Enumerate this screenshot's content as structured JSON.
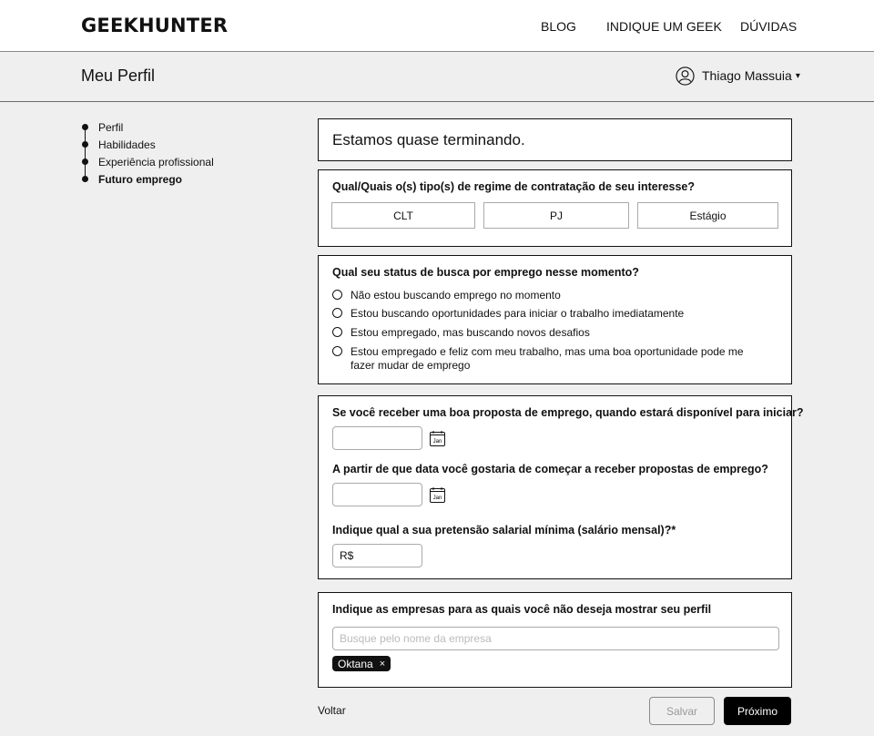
{
  "header": {
    "logo": "GEEKHUNTER",
    "nav": [
      "BLOG",
      "INDIQUE UM GEEK",
      "DÚVIDAS"
    ]
  },
  "subheader": {
    "title": "Meu Perfil",
    "user_name": "Thiago Massuia",
    "caret": "▾"
  },
  "steps": [
    {
      "label": "Perfil"
    },
    {
      "label": "Habilidades"
    },
    {
      "label": "Experiência profissional"
    },
    {
      "label": "Futuro emprego",
      "active": true
    }
  ],
  "intro": "Estamos quase terminando.",
  "regime": {
    "question": "Qual/Quais o(s) tipo(s) de regime de contratação de seu interesse?",
    "options": [
      "CLT",
      "PJ",
      "Estágio"
    ]
  },
  "status": {
    "question": "Qual seu status de busca por emprego nesse momento?",
    "options": [
      "Não estou buscando emprego no momento",
      "Estou buscando oportunidades para iniciar o trabalho imediatamente",
      "Estou empregado, mas buscando novos desafios",
      "Estou empregado e feliz com meu trabalho, mas uma boa oportunidade pode me fazer mudar de emprego"
    ]
  },
  "availability": {
    "q1": "Se você receber uma boa proposta de emprego, quando estará disponível para iniciar?",
    "q2": "A partir de que data você gostaria de começar a receber propostas de emprego?",
    "q3": "Indique qual a sua pretensão salarial mínima (salário mensal)?*",
    "salary_value": "R$",
    "calendar_label": "Jan"
  },
  "blocked": {
    "question": "Indique as empresas para as quais você não deseja mostrar seu perfil",
    "placeholder": "Busque pelo nome da empresa",
    "tags": [
      "Oktana"
    ],
    "remove_symbol": "×"
  },
  "footer": {
    "back": "Voltar",
    "save": "Salvar",
    "next": "Próximo"
  }
}
